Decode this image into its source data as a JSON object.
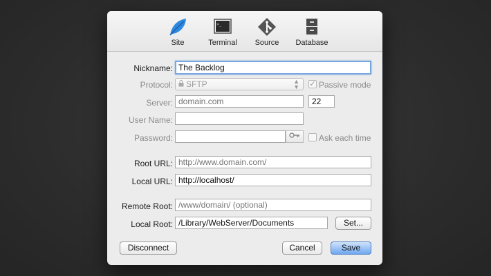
{
  "toolbar": {
    "tabs": [
      {
        "label": "Site",
        "icon": "leaf-icon"
      },
      {
        "label": "Terminal",
        "icon": "terminal-icon"
      },
      {
        "label": "Source",
        "icon": "source-icon"
      },
      {
        "label": "Database",
        "icon": "database-icon"
      }
    ]
  },
  "form": {
    "nickname": {
      "label": "Nickname:",
      "value": "The Backlog"
    },
    "protocol": {
      "label": "Protocol:",
      "value": "SFTP",
      "passive_label": "Passive mode"
    },
    "server": {
      "label": "Server:",
      "placeholder": "domain.com",
      "port": "22"
    },
    "username": {
      "label": "User Name:",
      "value": ""
    },
    "password": {
      "label": "Password:",
      "value": "",
      "ask_label": "Ask each time"
    },
    "root_url": {
      "label": "Root URL:",
      "placeholder": "http://www.domain.com/"
    },
    "local_url": {
      "label": "Local URL:",
      "value": "http://localhost/"
    },
    "remote_root": {
      "label": "Remote Root:",
      "placeholder": "/www/domain/ (optional)"
    },
    "local_root": {
      "label": "Local Root:",
      "value": "/Library/WebServer/Documents",
      "set_label": "Set..."
    }
  },
  "buttons": {
    "disconnect": "Disconnect",
    "cancel": "Cancel",
    "save": "Save"
  },
  "colors": {
    "accent": "#5b9bea",
    "leaf": "#2e88e0"
  }
}
